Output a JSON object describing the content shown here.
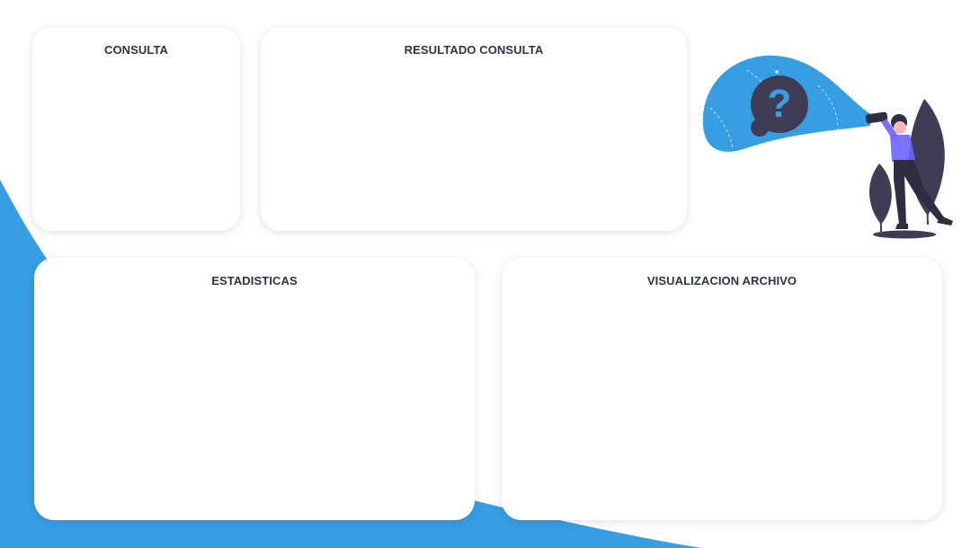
{
  "theme": {
    "accent": "#379ee4",
    "dark": "#3f3d56",
    "panel_bg": "#ffffff",
    "title_color": "#2f3540"
  },
  "panels": {
    "consulta": {
      "title": "CONSULTA"
    },
    "resultado": {
      "title": "RESULTADO CONSULTA"
    },
    "estadisticas": {
      "title": "ESTADISTICAS"
    },
    "visualizacion": {
      "title": "VISUALIZACION ARCHIVO"
    }
  },
  "illustration": {
    "icon": "question-searchlight-illustration"
  }
}
